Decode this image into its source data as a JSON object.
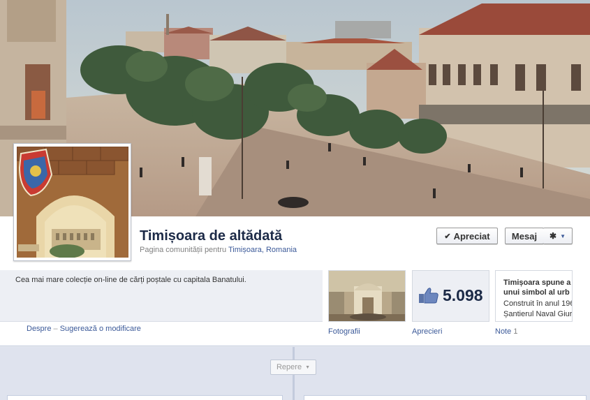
{
  "page": {
    "name": "Timișoara de altădată",
    "category_prefix": "Pagina comunității pentru",
    "location": "Timișoara, Romania"
  },
  "actions": {
    "liked_label": "Apreciat",
    "message_label": "Mesaj"
  },
  "about": {
    "description": "Cea mai mare colecție on-line de cărți poștale cu capitala Banatului.",
    "about_link": "Despre",
    "separator": "–",
    "suggest_link": "Sugerează o modificare"
  },
  "apps": {
    "photos_label": "Fotografii",
    "likes_count": "5.098",
    "likes_label": "Aprecieri",
    "notes_label": "Note",
    "notes_count": "1",
    "note_title_line1": "Timișoara spune a",
    "note_title_line2": "unui simbol al urb",
    "note_body_line1": "Construit în anul 196",
    "note_body_line2": "Șantierul Naval Giurg"
  },
  "timeline": {
    "milestones_label": "Repere"
  },
  "colors": {
    "link": "#3b5998",
    "title": "#1c2a47",
    "band": "#edeff4"
  }
}
